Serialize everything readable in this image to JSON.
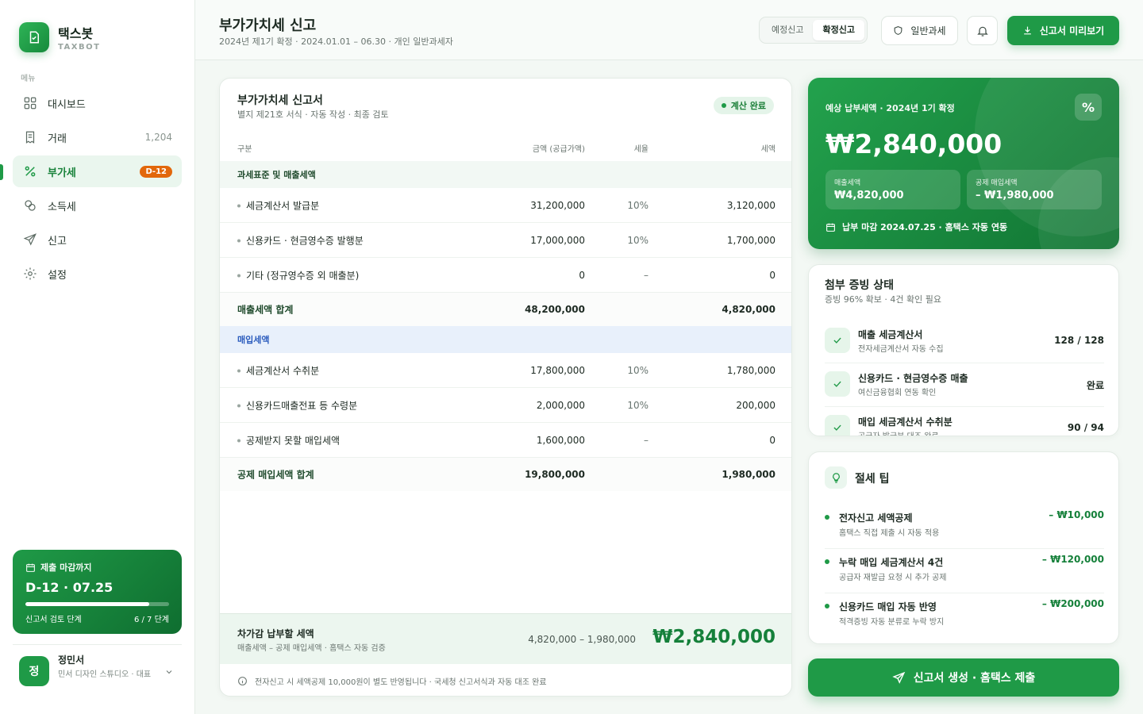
{
  "brand": {
    "name": "택스봇",
    "sub": "TAXBOT"
  },
  "sidebar": {
    "menu_title": "메뉴",
    "items": [
      {
        "label": "대시보드",
        "icon": "grid-icon"
      },
      {
        "label": "거래",
        "icon": "receipt-icon",
        "count": "1,204"
      },
      {
        "label": "부가세",
        "icon": "percent-icon",
        "badge": "D-12",
        "active": true
      },
      {
        "label": "소득세",
        "icon": "coins-icon"
      },
      {
        "label": "신고",
        "icon": "send-icon"
      },
      {
        "label": "설정",
        "icon": "gear-icon"
      }
    ],
    "deadline": {
      "label": "제출 마감까지",
      "date": "D-12 · 07.25",
      "progress": 0.86,
      "stage": "신고서 검토 단계",
      "stage_count": "6 / 7 단계"
    },
    "user": {
      "initial": "정",
      "name": "정민서",
      "role": "민서 디자인 스튜디오 · 대표"
    }
  },
  "header": {
    "title": "부가가치세 신고",
    "subtitle": "2024년 제1기 확정 · 2024.01.01 – 06.30 · 개인 일반과세자",
    "seg": [
      "예정신고",
      "확정신고"
    ],
    "type_label": "일반과세",
    "preview_label": "신고서 미리보기"
  },
  "form": {
    "title": "부가가치세 신고서",
    "subtitle": "별지 제21호 서식 · 자동 작성 · 최종 검토",
    "status": "계산 완료",
    "columns": [
      "구분",
      "금액 (공급가액)",
      "세율",
      "세액"
    ],
    "sales_section": "과세표준 및 매출세액",
    "sales_rows": [
      {
        "name": "세금계산서 발급분",
        "amount": "31,200,000",
        "rate": "10%",
        "tax": "3,120,000"
      },
      {
        "name": "신용카드 · 현금영수증 발행분",
        "amount": "17,000,000",
        "rate": "10%",
        "tax": "1,700,000"
      },
      {
        "name": "기타 (정규영수증 외 매출분)",
        "amount": "0",
        "rate": "–",
        "tax": "0"
      }
    ],
    "sales_total": {
      "name": "매출세액 합계",
      "amount": "48,200,000",
      "tax": "4,820,000"
    },
    "purchase_section": "매입세액",
    "purchase_rows": [
      {
        "name": "세금계산서 수취분",
        "amount": "17,800,000",
        "rate": "10%",
        "tax": "1,780,000"
      },
      {
        "name": "신용카드매출전표 등 수령분",
        "amount": "2,000,000",
        "rate": "10%",
        "tax": "200,000"
      },
      {
        "name": "공제받지 못할 매입세액",
        "amount": "1,600,000",
        "rate": "–",
        "tax": "0"
      }
    ],
    "purchase_total": {
      "name": "공제 매입세액 합계",
      "amount": "19,800,000",
      "tax": "1,980,000"
    },
    "footer": {
      "title": "차가감 납부할 세액",
      "sub": "매출세액 – 공제 매입세액 · 홈택스 자동 검증",
      "formula": "4,820,000 – 1,980,000",
      "value": "₩2,840,000"
    },
    "note": "전자신고 시 세액공제 10,000원이 별도 반영됩니다 · 국세청 신고서식과 자동 대조 완료"
  },
  "hero": {
    "label": "예상 납부세액 · 2024년 1기 확정",
    "amount": "₩2,840,000",
    "icon_text": "%",
    "sales_label": "매출세액",
    "sales_value": "₩4,820,000",
    "deduct_label": "공제 매입세액",
    "deduct_value": "– ₩1,980,000",
    "due": "납부 마감 2024.07.25 · 홈택스 자동 연동"
  },
  "attach": {
    "title": "첨부 증빙 상태",
    "subtitle": "증빙 96% 확보 · 4건 확인 필요",
    "rows": [
      {
        "name": "매출 세금계산서",
        "desc": "전자세금계산서 자동 수집",
        "value": "128 / 128"
      },
      {
        "name": "신용카드 · 현금영수증 매출",
        "desc": "여신금융협회 연동 확인",
        "value": "완료"
      },
      {
        "name": "매입 세금계산서 수취분",
        "desc": "공급자 발급분 대조 완료",
        "value": "90 / 94"
      }
    ]
  },
  "tips": {
    "title": "절세 팁",
    "rows": [
      {
        "name": "전자신고 세액공제",
        "desc": "홈택스 직접 제출 시 자동 적용",
        "value": "– ₩10,000"
      },
      {
        "name": "누락 매입 세금계산서 4건",
        "desc": "공급자 재발급 요청 시 추가 공제",
        "value": "– ₩120,000"
      },
      {
        "name": "신용카드 매입 자동 반영",
        "desc": "적격증빙 자동 분류로 누락 방지",
        "value": "– ₩200,000"
      }
    ]
  },
  "cta": {
    "label": "신고서 생성 · 홈택스 제출"
  },
  "colors": {
    "brand": "#1f9a47",
    "brand_dark": "#117433",
    "warning": "#e2670b",
    "purchase_section": "#2a5bbd"
  }
}
